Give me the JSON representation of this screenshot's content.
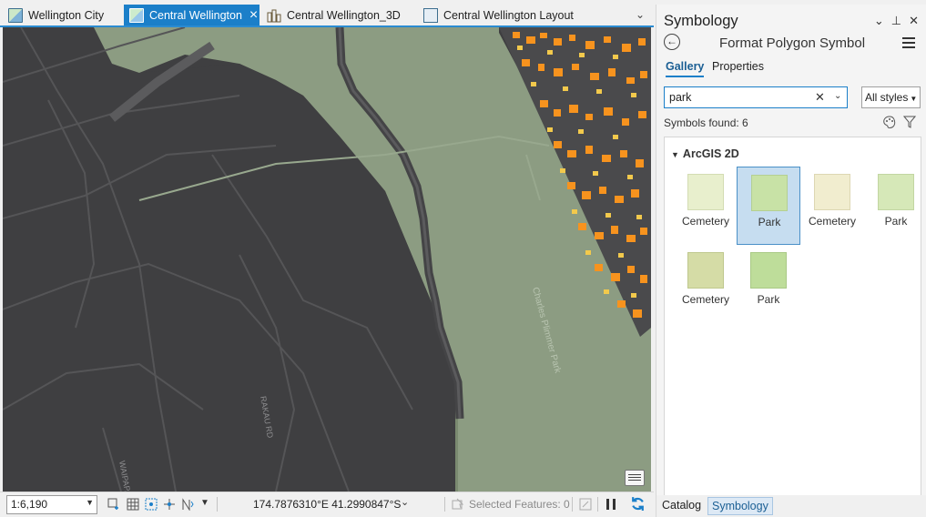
{
  "tabs": [
    {
      "label": "Wellington City",
      "icon": "map-icon",
      "active": false
    },
    {
      "label": "Central Wellington",
      "icon": "map-icon",
      "active": true
    },
    {
      "label": "Central Wellington_3D",
      "icon": "scene-icon",
      "active": false
    },
    {
      "label": "Central Wellington Layout",
      "icon": "layout-icon",
      "active": false
    }
  ],
  "tab_overflow": "⌄",
  "map": {
    "labels": {
      "park": "Charles Plimmer Park",
      "street1": "RAKAU RD",
      "street2": "WAIPAPA"
    },
    "colors": {
      "background": "#3f3f41",
      "park": "#8c9c82",
      "roads": "#5a5a5c",
      "buildings_orange": "#f7931e",
      "buildings_yellow": "#f2c94c"
    }
  },
  "statusbar": {
    "scale": "1:6,190",
    "coords": "174.7876310°E 41.2990847°S",
    "selected_features": "Selected Features: 0"
  },
  "pane": {
    "title": "Symbology",
    "subtitle": "Format Polygon Symbol",
    "tabs": {
      "gallery": "Gallery",
      "properties": "Properties"
    },
    "search_value": "park",
    "styles_label": "All styles",
    "symbols_found": "Symbols found: 6",
    "group": "ArcGIS 2D",
    "symbols": [
      {
        "label": "Cemetery",
        "fill": "#e8efcd",
        "stroke": "#d3dcb3",
        "selected": false
      },
      {
        "label": "Park",
        "fill": "#c8e2a6",
        "stroke": "#b4cf92",
        "selected": true
      },
      {
        "label": "Cemetery",
        "fill": "#f1edcf",
        "stroke": "#ddd7b3",
        "selected": false
      },
      {
        "label": "Park",
        "fill": "#d6e8b8",
        "stroke": "#c2d6a2",
        "selected": false
      },
      {
        "label": "Cemetery",
        "fill": "#d5dca6",
        "stroke": "#bfc88e",
        "selected": false
      },
      {
        "label": "Park",
        "fill": "#bedd9a",
        "stroke": "#a9c985",
        "selected": false
      }
    ],
    "bottom_tabs": {
      "catalog": "Catalog",
      "symbology": "Symbology"
    }
  }
}
